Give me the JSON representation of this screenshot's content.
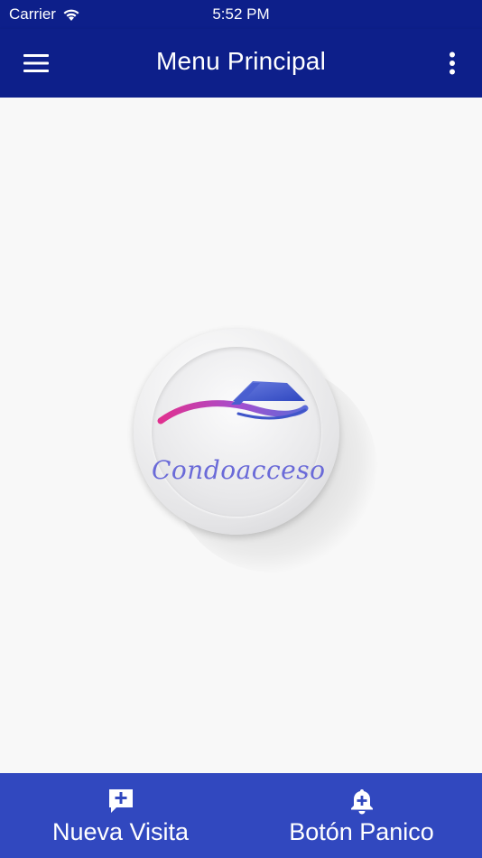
{
  "status_bar": {
    "carrier": "Carrier",
    "time": "5:52 PM"
  },
  "app_bar": {
    "title": "Menu Principal",
    "menu_icon": "hamburger-icon",
    "more_icon": "more-vert-icon"
  },
  "logo": {
    "text": "Condoacceso"
  },
  "bottom_nav": {
    "items": [
      {
        "label": "Nueva Visita",
        "icon": "add-comment-icon"
      },
      {
        "label": "Botón Panico",
        "icon": "alarm-add-bell-icon"
      }
    ]
  },
  "colors": {
    "app_bar": "#0d1f8a",
    "bottom_bar": "#3148bf",
    "background": "#f8f8f8",
    "logo_swoosh_start": "#e0308f",
    "logo_swoosh_end": "#5a6bd8",
    "logo_roof": "#3f55c9"
  }
}
